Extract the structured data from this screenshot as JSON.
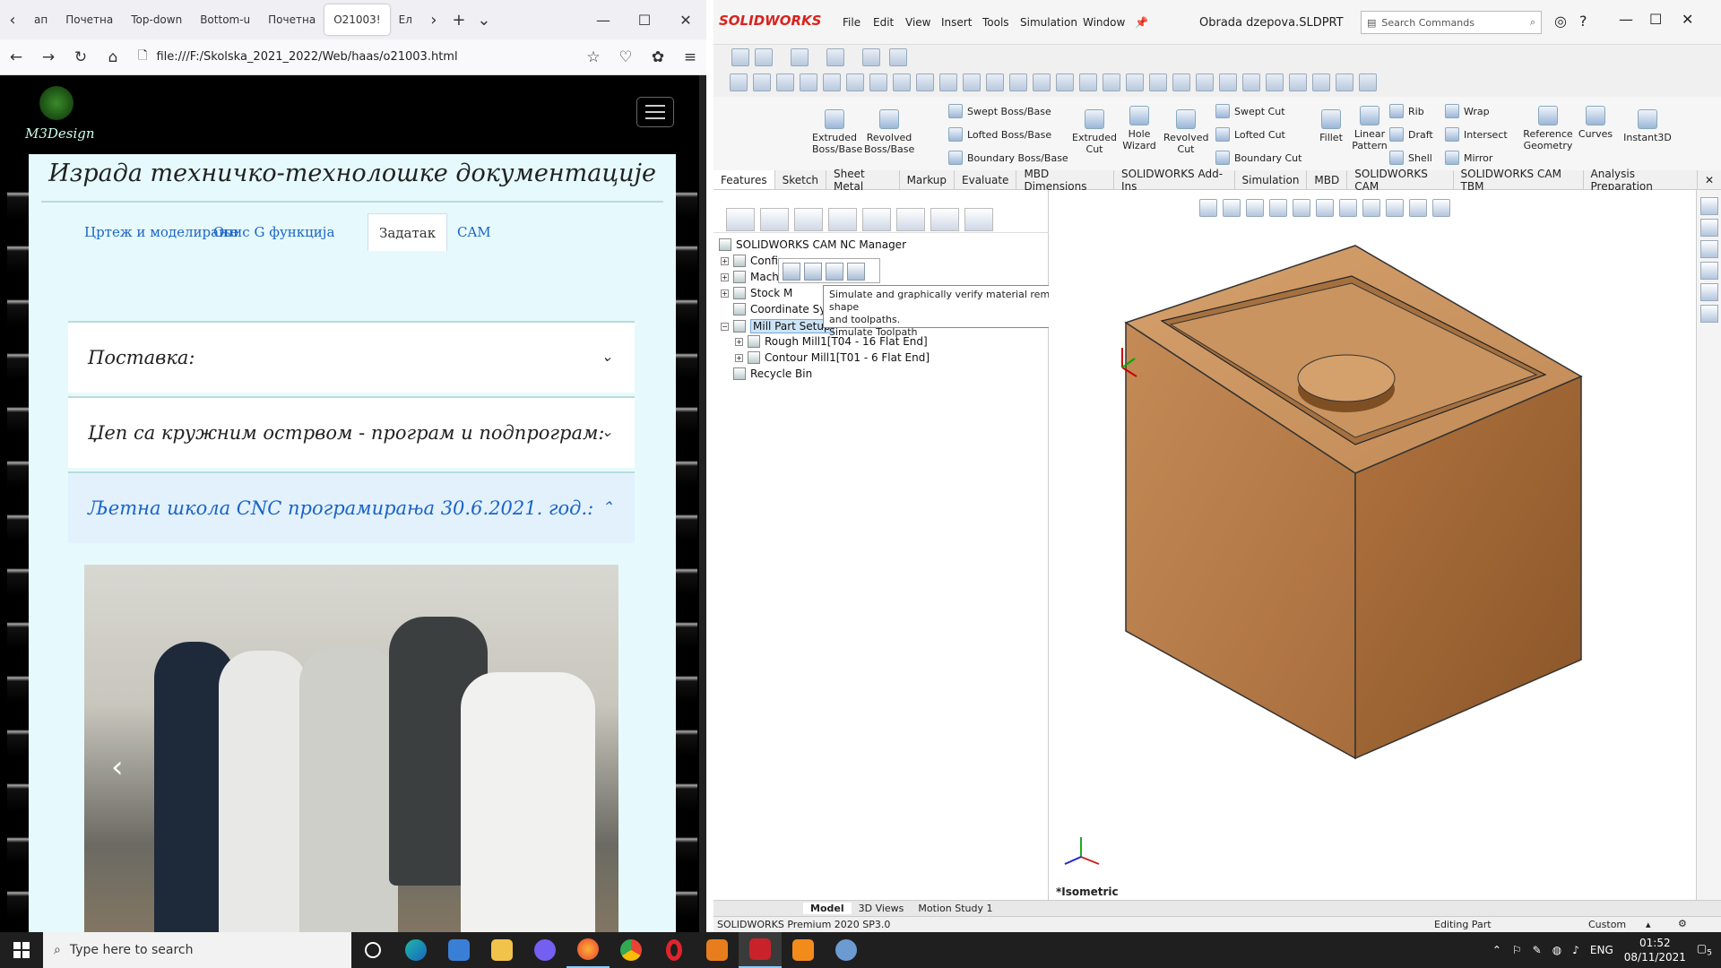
{
  "firefox": {
    "tabs": [
      "ап",
      "Почетна",
      "Top-down",
      "Bottom-u",
      "Почетна",
      "O21003!",
      "Ел"
    ],
    "url": "file:///F:/Skolska_2021_2022/Web/haas/o21003.html",
    "logo_text": "M3Design",
    "page": {
      "title": "Израда техничко-технолошке документације",
      "tabs": [
        "Цртеж и моделирање",
        "Опис G функција",
        "Задатак",
        "CAM"
      ],
      "accordion": [
        "Поставка:",
        "Џеп са кружним острвом - програм и подпрограм:",
        "Љетна школа CNC програмирања 30.6.2021. год.:"
      ]
    }
  },
  "solidworks": {
    "brand": "SOLIDWORKS",
    "menu": [
      "File",
      "Edit",
      "View",
      "Insert",
      "Tools",
      "Simulation",
      "Window"
    ],
    "doc_title": "Obrada dzepova.SLDPRT",
    "search_placeholder": "Search Commands",
    "commands": {
      "extruded_boss": "Extruded Boss/Base",
      "revolved_boss": "Revolved Boss/Base",
      "swept_boss": "Swept Boss/Base",
      "lofted_boss": "Lofted Boss/Base",
      "boundary_boss": "Boundary Boss/Base",
      "extruded_cut": "Extruded Cut",
      "hole_wizard": "Hole Wizard",
      "revolved_cut": "Revolved Cut",
      "swept_cut": "Swept Cut",
      "lofted_cut": "Lofted Cut",
      "boundary_cut": "Boundary Cut",
      "fillet": "Fillet",
      "linear_pattern": "Linear Pattern",
      "rib": "Rib",
      "draft": "Draft",
      "shell": "Shell",
      "wrap": "Wrap",
      "intersect": "Intersect",
      "mirror": "Mirror",
      "ref_geometry": "Reference Geometry",
      "curves": "Curves",
      "instant3d": "Instant3D"
    },
    "tabs": [
      "Features",
      "Sketch",
      "Sheet Metal",
      "Markup",
      "Evaluate",
      "MBD Dimensions",
      "SOLIDWORKS Add-Ins",
      "Simulation",
      "MBD",
      "SOLIDWORKS CAM",
      "SOLIDWORKS CAM TBM",
      "Analysis Preparation"
    ],
    "tree": {
      "root": "SOLIDWORKS CAM NC Manager",
      "items": [
        "Config",
        "Machi",
        "Stock M",
        "Coordinate Sys",
        "Mill Part Setup",
        "Rough Mill1[T04 - 16 Flat End]",
        "Contour Mill1[T01 - 6 Flat End]",
        "Recycle Bin"
      ]
    },
    "tooltip": {
      "line1": "Simulate and graphically verify material removal based on the stock shape",
      "line2": "and toolpaths.",
      "line3": "Simulate Toolpath"
    },
    "view_label": "*Isometric",
    "bottom_tabs": [
      "Model",
      "3D Views",
      "Motion Study 1"
    ],
    "status": {
      "version": "SOLIDWORKS Premium 2020 SP3.0",
      "mode": "Editing Part",
      "units": "Custom"
    }
  },
  "taskbar": {
    "search_placeholder": "Type here to search",
    "lang": "ENG",
    "time": "01:52",
    "date": "08/11/2021",
    "notif_count": "5"
  }
}
